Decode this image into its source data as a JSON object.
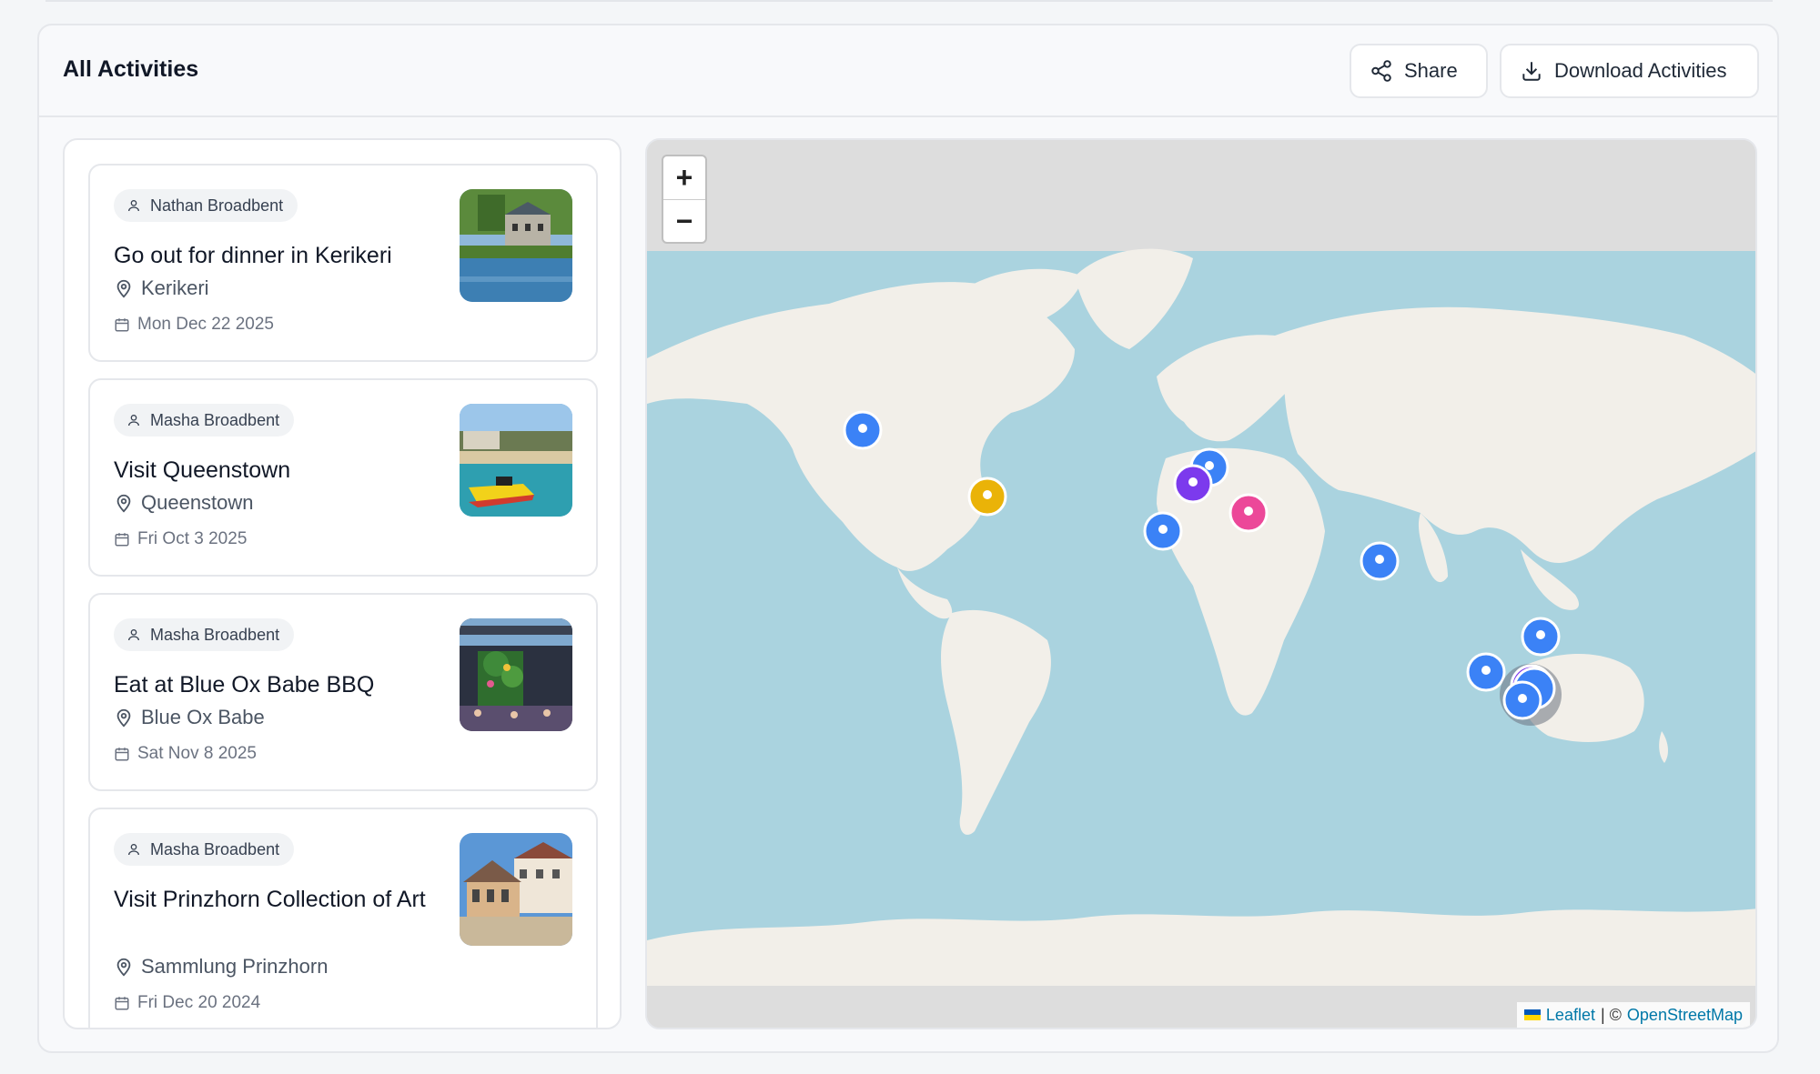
{
  "header": {
    "title": "All Activities",
    "share_label": "Share",
    "download_label": "Download Activities"
  },
  "activities": [
    {
      "person": "Nathan Broadbent",
      "title": "Go out for dinner in Kerikeri",
      "place": "Kerikeri",
      "date": "Mon Dec 22 2025"
    },
    {
      "person": "Masha Broadbent",
      "title": "Visit Queenstown",
      "place": "Queenstown",
      "date": "Fri Oct 3 2025"
    },
    {
      "person": "Masha Broadbent",
      "title": "Eat at Blue Ox Babe BBQ",
      "place": "Blue Ox Babe",
      "date": "Sat Nov 8 2025"
    },
    {
      "person": "Masha Broadbent",
      "title": "Visit Prinzhorn Collection of Art",
      "place": "Sammlung Prinzhorn",
      "date": "Fri Dec 20 2024"
    }
  ],
  "map": {
    "zoom_in": "+",
    "zoom_out": "−",
    "attribution_leaflet": "Leaflet",
    "attribution_sep": "| ©",
    "attribution_osm": "OpenStreetMap",
    "marker_colors": {
      "blue": "#3b82f6",
      "yellow": "#eab308",
      "purple": "#7c3aed",
      "pink": "#ec4899"
    }
  }
}
